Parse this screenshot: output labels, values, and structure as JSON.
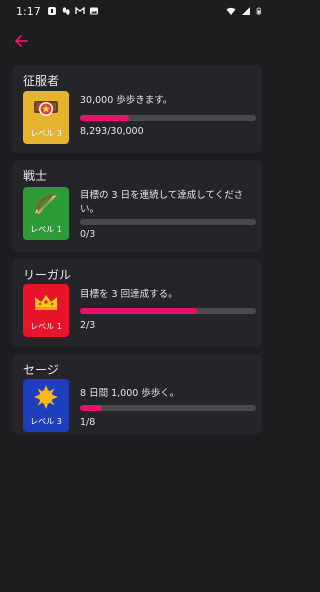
{
  "status": {
    "time": "1:17"
  },
  "accent": "#e9106f",
  "achievements": [
    {
      "title": "征服者",
      "level": "レベル 3",
      "badge_color": "#e6b32e",
      "icon": "medal-icon",
      "description": "30,000 歩歩きます。",
      "progress_text": "8,293/30,000",
      "progress": 0.276
    },
    {
      "title": "戦士",
      "level": "レベル 1",
      "badge_color": "#2e9b3a",
      "icon": "bow-arrow-icon",
      "description": "目標の 3 日を連続して達成してください。",
      "progress_text": "0/3",
      "progress": 0
    },
    {
      "title": "リーガル",
      "level": "レベル 1",
      "badge_color": "#e7142a",
      "icon": "crown-icon",
      "description": "目標を 3 回達成する。",
      "progress_text": "2/3",
      "progress": 0.667
    },
    {
      "title": "セージ",
      "level": "レベル 3",
      "badge_color": "#1e3fbd",
      "icon": "sun-icon",
      "description": "8 日間 1,000 歩歩く。",
      "progress_text": "1/8",
      "progress": 0.125
    }
  ]
}
